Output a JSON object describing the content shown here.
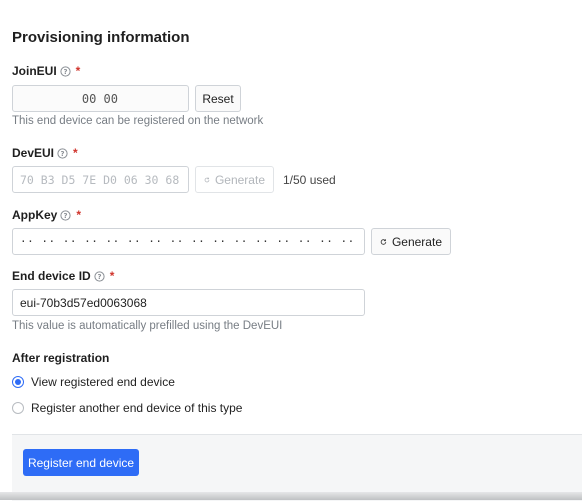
{
  "section": {
    "title": "Provisioning information"
  },
  "join_eui": {
    "label": "JoinEUI",
    "required_mark": "*",
    "value": "00 00",
    "reset_label": "Reset",
    "hint": "This end device can be registered on the network"
  },
  "dev_eui": {
    "label": "DevEUI",
    "required_mark": "*",
    "placeholder": "70 B3 D5 7E D0 06 30 68",
    "generate_label": "Generate",
    "usage": "1/50 used"
  },
  "app_key": {
    "label": "AppKey",
    "required_mark": "*",
    "value": "·· ·· ·· ·· ·· ·· ·· ·· ·· ·· ·· ·· ·· ·· ·· ··",
    "generate_label": "Generate"
  },
  "end_device_id": {
    "label": "End device ID",
    "required_mark": "*",
    "value": "eui-70b3d57ed0063068",
    "hint": "This value is automatically prefilled using the DevEUI"
  },
  "after_registration": {
    "label": "After registration",
    "options": [
      {
        "label": "View registered end device",
        "checked": true
      },
      {
        "label": "Register another end device of this type",
        "checked": false
      }
    ]
  },
  "footer": {
    "submit_label": "Register end device"
  },
  "colors": {
    "accent": "#2e6cf6",
    "required": "#d0342c",
    "hint": "#777d84"
  },
  "icons": {
    "help": "question-circle-icon",
    "generate": "refresh-icon"
  }
}
